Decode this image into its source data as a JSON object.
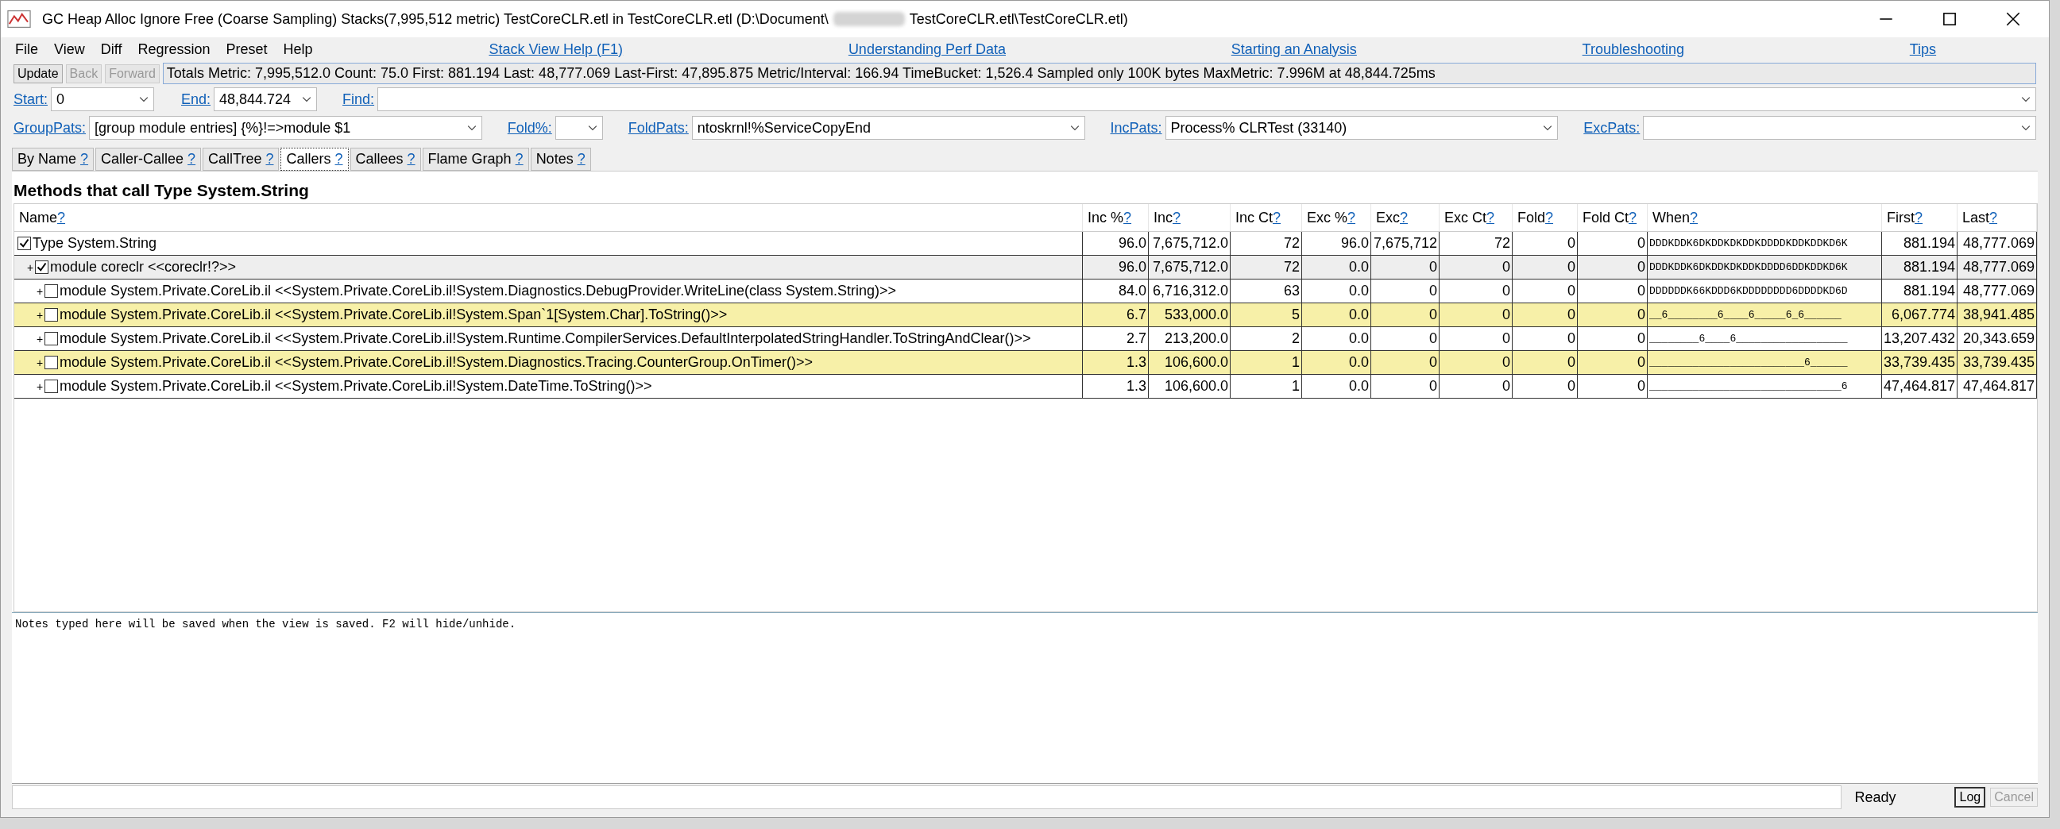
{
  "window": {
    "title_start": "GC Heap Alloc Ignore Free (Coarse Sampling) Stacks(7,995,512 metric) TestCoreCLR.etl in TestCoreCLR.etl (D:\\Document\\",
    "title_end": "TestCoreCLR.etl\\TestCoreCLR.etl)"
  },
  "menu": [
    "File",
    "View",
    "Diff",
    "Regression",
    "Preset",
    "Help"
  ],
  "help_links": [
    "Stack View Help (F1)",
    "Understanding Perf Data",
    "Starting an Analysis",
    "Troubleshooting",
    "Tips"
  ],
  "nav_buttons": [
    {
      "label": "Update",
      "disabled": false
    },
    {
      "label": "Back",
      "disabled": true
    },
    {
      "label": "Forward",
      "disabled": true
    }
  ],
  "totals": "Totals Metric: 7,995,512.0  Count: 75.0  First: 881.194 Last: 48,777.069  Last-First: 47,895.875  Metric/Interval: 166.94  TimeBucket: 1,526.4 Sampled only 100K bytes MaxMetric: 7.996M at 48,844.725ms",
  "range": {
    "start_label": "Start:",
    "start": "0",
    "end_label": "End:",
    "end": "48,844.724",
    "find_label": "Find:"
  },
  "filters": [
    {
      "label": "GroupPats:",
      "value": "[group module entries]  {%}!=>module $1"
    },
    {
      "label": "Fold%:"
    },
    {
      "label": "FoldPats:",
      "value": "ntoskrnl!%ServiceCopyEnd"
    },
    {
      "label": "IncPats:",
      "value": "Process% CLRTest (33140)"
    },
    {
      "label": "ExcPats:"
    }
  ],
  "tabs": [
    {
      "label": "By Name",
      "help": "?",
      "selected": false
    },
    {
      "label": "Caller-Callee",
      "help": "?",
      "selected": false
    },
    {
      "label": "CallTree",
      "help": "?",
      "selected": false
    },
    {
      "label": "Callers",
      "help": "?",
      "selected": true
    },
    {
      "label": "Callees",
      "help": "?",
      "selected": false
    },
    {
      "label": "Flame Graph",
      "help": "?",
      "selected": false
    },
    {
      "label": "Notes",
      "help": "?",
      "selected": false
    }
  ],
  "heading": "Methods that call Type System.String",
  "columns": [
    {
      "label": "Name",
      "help": "?"
    },
    {
      "label": "Inc %",
      "help": "?"
    },
    {
      "label": "Inc",
      "help": "?"
    },
    {
      "label": "Inc Ct",
      "help": "?"
    },
    {
      "label": "Exc %",
      "help": "?"
    },
    {
      "label": "Exc",
      "help": "?"
    },
    {
      "label": "Exc Ct",
      "help": "?"
    },
    {
      "label": "Fold",
      "help": "?"
    },
    {
      "label": "Fold Ct",
      "help": "?"
    },
    {
      "label": "When",
      "help": "?"
    },
    {
      "label": "First",
      "help": "?"
    },
    {
      "label": "Last",
      "help": "?"
    }
  ],
  "rows": [
    {
      "name": "Type System.String",
      "checked": true,
      "selected": false,
      "highlighted": false,
      "cells": [
        "96.0",
        "7,675,712.0",
        "72",
        "96.0",
        "7,675,712",
        "72",
        "0",
        "0"
      ],
      "when": "DDDKDDK6DKDDKDKDDKDDDDKDDKDDKD6K",
      "first": "881.194",
      "last": "48,777.069",
      "children": [
        {
          "expander": "+",
          "name": "module coreclr <<coreclr!?>>",
          "checked": true,
          "selected": true,
          "highlighted": false,
          "cells": [
            "96.0",
            "7,675,712.0",
            "72",
            "0.0",
            "0",
            "0",
            "0",
            "0"
          ],
          "when": "DDDKDDK6DKDDKDKDDKDDDD6DDKDDKD6K",
          "first": "881.194",
          "last": "48,777.069",
          "children": [
            {
              "expander": "+",
              "name": "module System.Private.CoreLib.il <<System.Private.CoreLib.il!System.Diagnostics.DebugProvider.WriteLine(class System.String)>>",
              "checked": false,
              "selected": false,
              "highlighted": false,
              "cells": [
                "84.0",
                "6,716,312.0",
                "63",
                "0.0",
                "0",
                "0",
                "0",
                "0"
              ],
              "when": "DDDDDDK66KDDD6KDDDDDDDD6DDDDKD6D",
              "first": "881.194",
              "last": "48,777.069"
            },
            {
              "expander": "+",
              "name": "module System.Private.CoreLib.il <<System.Private.CoreLib.il!System.Span`1[System.Char].ToString()>>",
              "checked": false,
              "selected": false,
              "highlighted": true,
              "cells": [
                "6.7",
                "533,000.0",
                "5",
                "0.0",
                "0",
                "0",
                "0",
                "0"
              ],
              "when": "__6________6____6_____6_6______",
              "first": "6,067.774",
              "last": "38,941.485"
            },
            {
              "expander": "+",
              "name": "module System.Private.CoreLib.il <<System.Private.CoreLib.il!System.Runtime.CompilerServices.DefaultInterpolatedStringHandler.ToStringAndClear()>>",
              "checked": false,
              "selected": false,
              "highlighted": false,
              "cells": [
                "2.7",
                "213,200.0",
                "2",
                "0.0",
                "0",
                "0",
                "0",
                "0"
              ],
              "when": "________6____6__________________",
              "first": "13,207.432",
              "last": "20,343.659"
            },
            {
              "expander": "+",
              "name": "module System.Private.CoreLib.il <<System.Private.CoreLib.il!System.Diagnostics.Tracing.CounterGroup.OnTimer()>>",
              "checked": false,
              "selected": false,
              "highlighted": true,
              "cells": [
                "1.3",
                "106,600.0",
                "1",
                "0.0",
                "0",
                "0",
                "0",
                "0"
              ],
              "when": "_________________________6______",
              "first": "33,739.435",
              "last": "33,739.435"
            },
            {
              "expander": "+",
              "name": "module System.Private.CoreLib.il <<System.Private.CoreLib.il!System.DateTime.ToString()>>",
              "checked": false,
              "selected": false,
              "highlighted": false,
              "cells": [
                "1.3",
                "106,600.0",
                "1",
                "0.0",
                "0",
                "0",
                "0",
                "0"
              ],
              "when": "_______________________________6",
              "first": "47,464.817",
              "last": "47,464.817"
            }
          ]
        }
      ]
    }
  ],
  "notes": "Notes typed here will be saved when the view is saved. F2 will hide/unhide.",
  "status": {
    "text": "Ready",
    "buttons": [
      {
        "label": "Log",
        "disabled": false
      },
      {
        "label": "Cancel",
        "disabled": true
      }
    ]
  }
}
